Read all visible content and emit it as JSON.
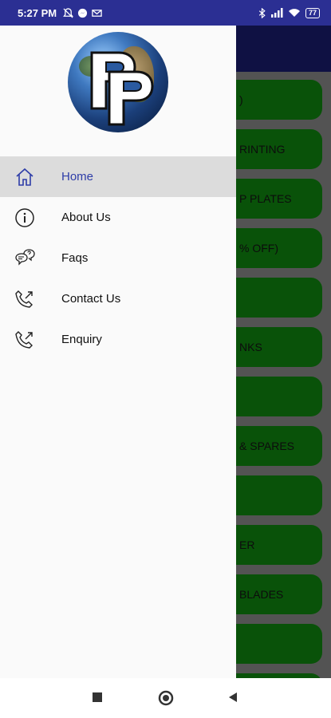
{
  "status_bar": {
    "time": "5:27 PM",
    "battery": "77"
  },
  "drawer": {
    "menu_items": [
      {
        "label": "Home",
        "icon": "home-icon",
        "active": true
      },
      {
        "label": "About Us",
        "icon": "info-icon",
        "active": false
      },
      {
        "label": "Faqs",
        "icon": "faq-chat-icon",
        "active": false
      },
      {
        "label": "Contact Us",
        "icon": "phone-call-icon",
        "active": false
      },
      {
        "label": "Enquiry",
        "icon": "phone-call-icon",
        "active": false
      }
    ],
    "active_color": "#2e3da8"
  },
  "background_list": {
    "items": [
      ")",
      "RINTING",
      "P PLATES",
      "% OFF)",
      "",
      "NKS",
      "",
      "& SPARES",
      "",
      "ER",
      "BLADES",
      "",
      ""
    ],
    "item_color": "#0d6e0d"
  },
  "colors": {
    "status_bar": "#2b2f93",
    "app_bar": "#14175a"
  }
}
